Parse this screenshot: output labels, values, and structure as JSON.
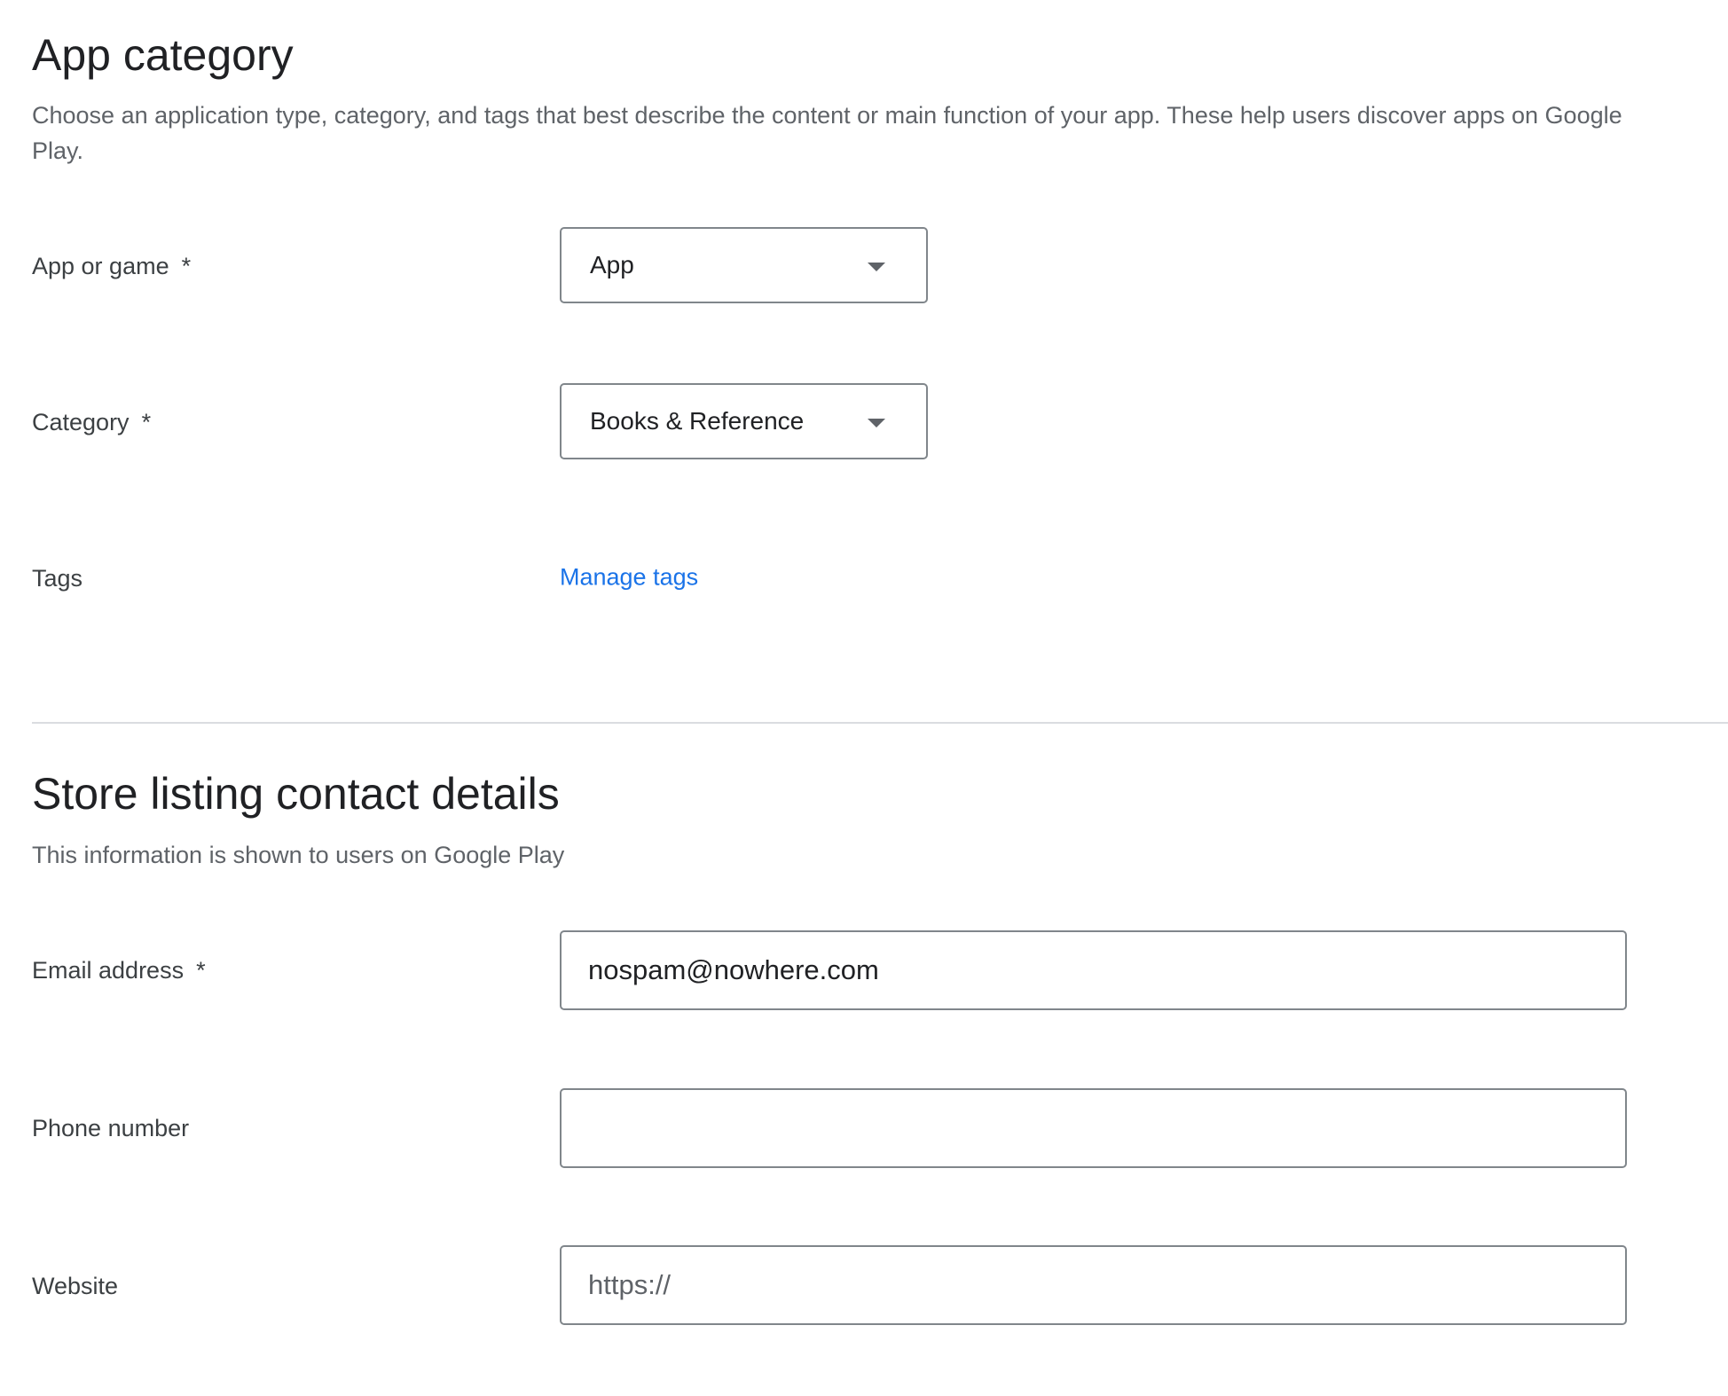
{
  "app_category": {
    "title": "App category",
    "description": "Choose an application type, category, and tags that best describe the content or main function of your app. These help users discover apps on Google Play.",
    "app_or_game": {
      "label": "App or game",
      "required_mark": "*",
      "value": "App"
    },
    "category": {
      "label": "Category",
      "required_mark": "*",
      "value": "Books & Reference"
    },
    "tags": {
      "label": "Tags",
      "link": "Manage tags"
    }
  },
  "contact": {
    "title": "Store listing contact details",
    "description": "This information is shown to users on Google Play",
    "email": {
      "label": "Email address",
      "required_mark": "*",
      "value": "nospam@nowhere.com"
    },
    "phone": {
      "label": "Phone number",
      "value": ""
    },
    "website": {
      "label": "Website",
      "placeholder": "https://"
    }
  }
}
